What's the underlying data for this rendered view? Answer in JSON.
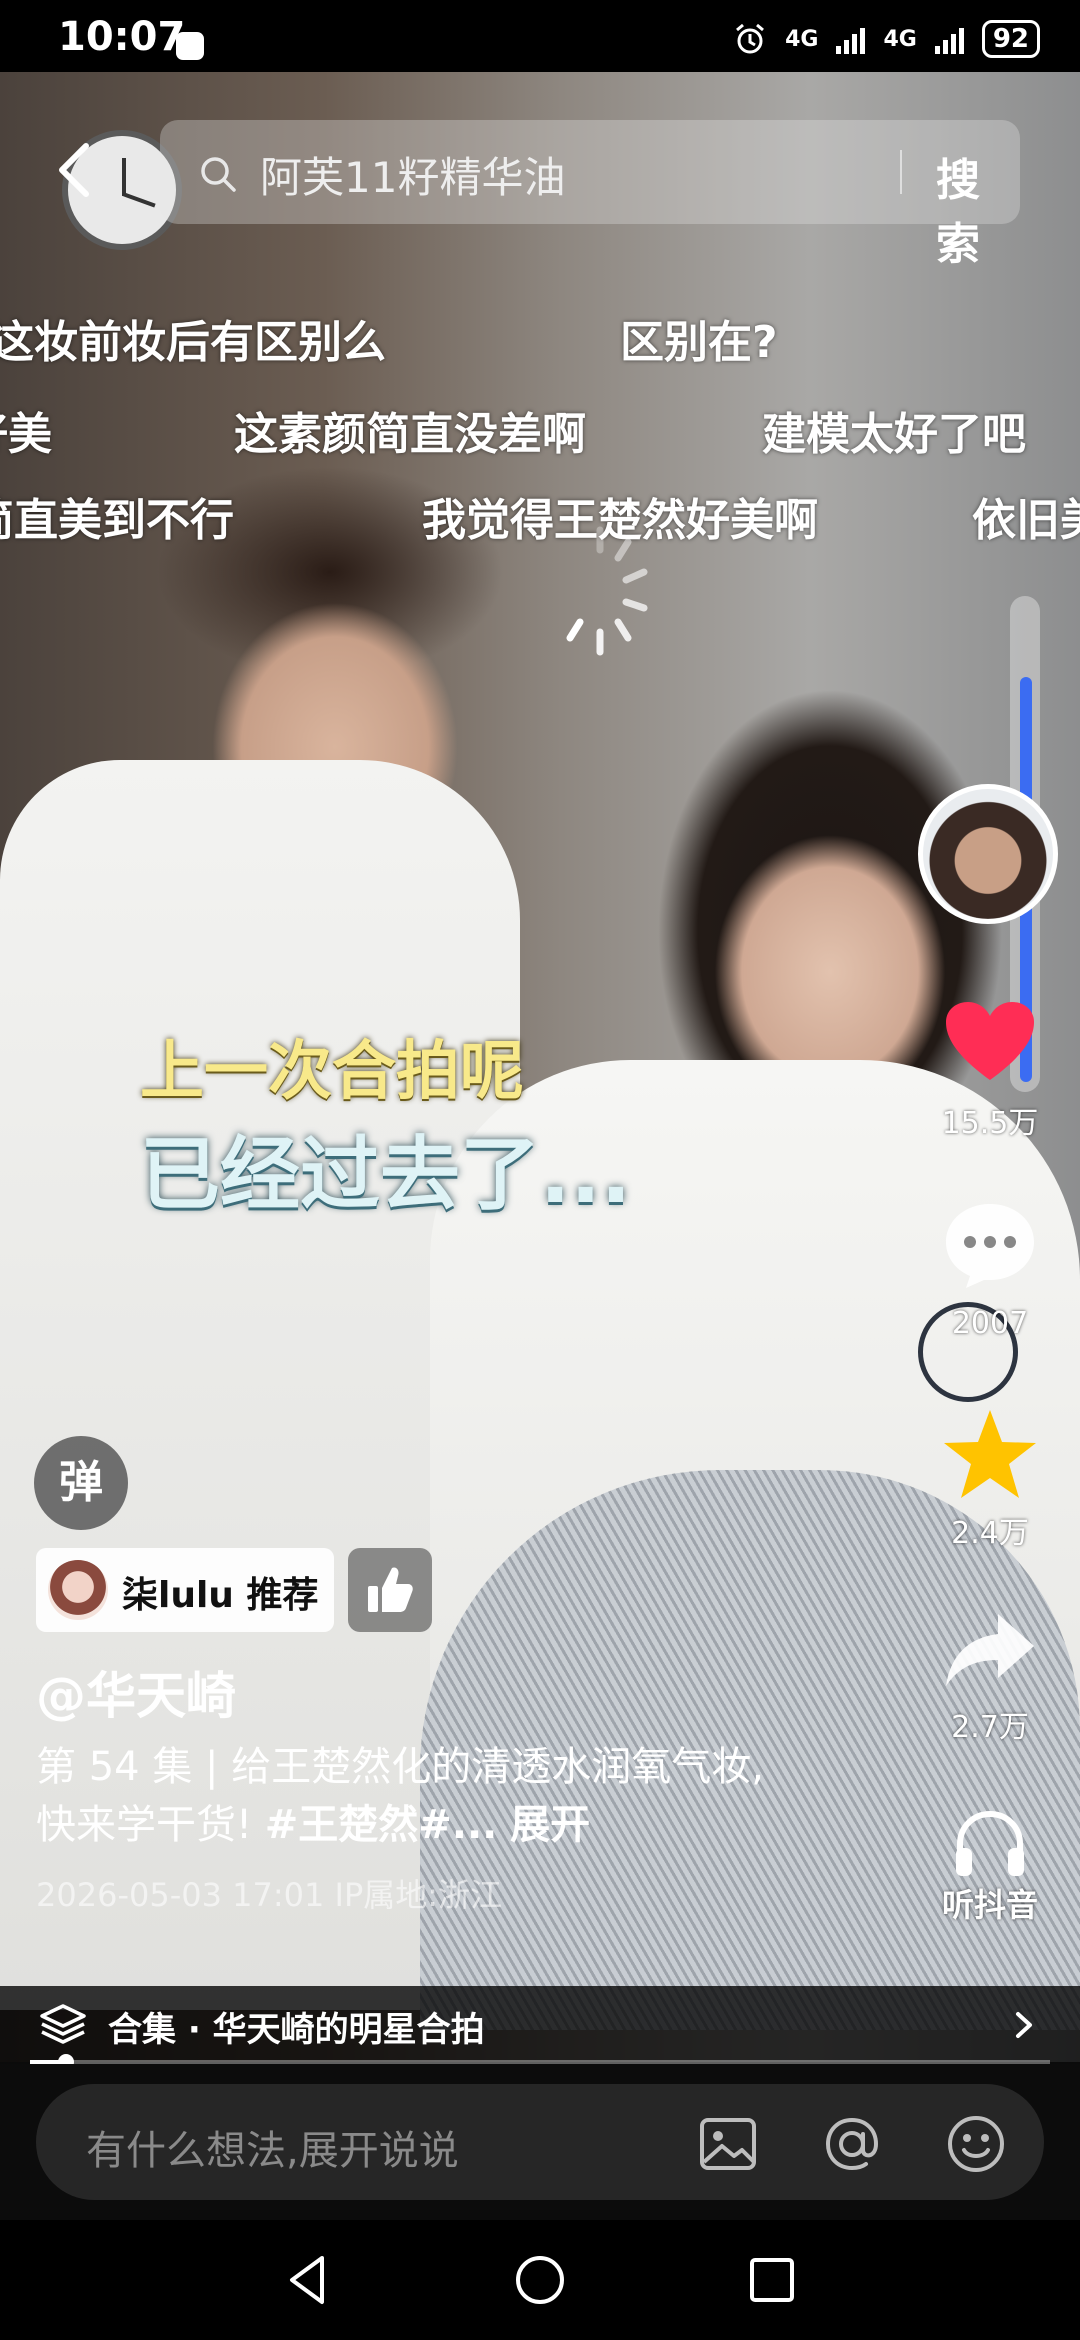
{
  "status_bar": {
    "time": "10:07",
    "network_1": "4G",
    "network_2": "4G",
    "battery": "92"
  },
  "search": {
    "query": "阿芙11籽精华油",
    "button_label": "搜索"
  },
  "danmaku": [
    "这妆前妆后有区别么",
    "区别在?",
    "好美",
    "这素颜简直没差啊",
    "建模太好了吧",
    "简直美到不行",
    "我觉得王楚然好美啊",
    "依旧美"
  ],
  "subtitles": {
    "line1": "上一次合拍呢",
    "line2": "已经过去了..."
  },
  "vertical_progress": 0.85,
  "actions": {
    "like_count": "15.5万",
    "comment_count": "2007",
    "favorite_count": "2.4万",
    "share_count": "2.7万",
    "listen_label": "听抖音"
  },
  "danmaku_toggle_label": "弹",
  "recommend_label": "柒lulu 推荐",
  "post": {
    "author": "@华天崎",
    "desc_prefix": "第 54 集 | 给王楚然化的清透水润氧气妆,快来学干货!",
    "hashtag": "#王楚然#...",
    "expand": "展开",
    "meta": "2026-05-03 17:01  IP属地:浙江"
  },
  "collection_label": "合集 · 华天崎的明星合拍",
  "video_progress": 0.035,
  "comment": {
    "placeholder": "有什么想法,展开说说"
  },
  "icons": [
    "back-icon",
    "search-icon",
    "layers-icon",
    "chevron-right-icon",
    "heart-icon",
    "comment-icon",
    "star-icon",
    "share-icon",
    "headphones-icon",
    "thumbs-up-icon",
    "image-icon",
    "at-icon",
    "emoji-icon",
    "nav-back-icon",
    "nav-home-icon",
    "nav-recents-icon"
  ],
  "colors": {
    "like": "#ff2d55",
    "favorite": "#ffc300",
    "progress": "#3b6cf2",
    "subtitle_line1": "#f8e98a",
    "subtitle_line2": "#dff3f6"
  }
}
